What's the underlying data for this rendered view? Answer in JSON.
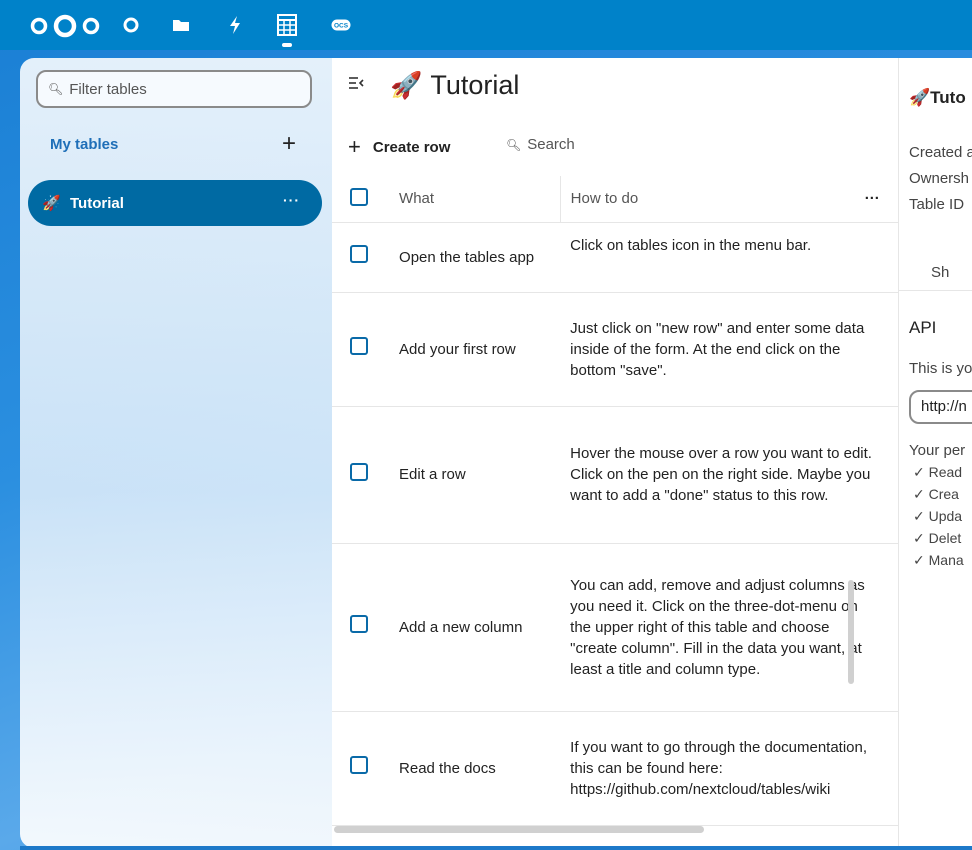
{
  "topbar": {
    "apps": [
      {
        "name": "dashboard-icon"
      },
      {
        "name": "files-icon"
      },
      {
        "name": "activity-icon"
      },
      {
        "name": "tables-icon"
      },
      {
        "name": "ocs-icon",
        "label": "OCS"
      }
    ]
  },
  "sidebar": {
    "filter_placeholder": "Filter tables",
    "section_label": "My tables",
    "add_label": "+",
    "items": [
      {
        "emoji": "🚀",
        "label": "Tutorial",
        "menu": "···"
      }
    ]
  },
  "main": {
    "title_emoji": "🚀",
    "title": "Tutorial",
    "create_row_icon": "+",
    "create_row_label": "Create row",
    "search_label": "Search",
    "columns": {
      "what": "What",
      "how": "How to do",
      "menu": "···"
    },
    "rows": [
      {
        "what": "Open the tables app",
        "how": "Click on tables icon in the menu bar.",
        "stars": "★★"
      },
      {
        "what": "Add your first row",
        "how": "Just click on \"new row\" and enter some data inside of the form. At the end click on the bottom \"save\".",
        "stars": "★★"
      },
      {
        "what": "Edit a row",
        "how": "Hover the mouse over a row you want to edit. Click on the pen on the right side. Maybe you want to add a \"done\" status to this row.",
        "stars": "★★"
      },
      {
        "what": "Add a new column",
        "how": "You can add, remove and adjust columns as you need it. Click on the three-dot-menu on the upper right of this table and choose \"create column\". Fill in the data you want, at least a title and column type.",
        "stars": "★★"
      },
      {
        "what": "Read the docs",
        "how": "If you want to go through the documentation, this can be found here: https://github.com/nextcloud/tables/wiki",
        "stars": "★★"
      }
    ]
  },
  "details": {
    "title_emoji": "🚀",
    "title": "Tuto",
    "created": "Created a",
    "ownership": "Ownersh",
    "table_id": "Table ID",
    "share": "Sh",
    "api_heading": "API",
    "api_text": "This is yo",
    "api_url": "http://n",
    "permissions_label": "Your per",
    "permissions": [
      "✓ Read",
      "✓ Crea",
      "✓ Upda",
      "✓ Delet",
      "✓ Mana"
    ]
  }
}
